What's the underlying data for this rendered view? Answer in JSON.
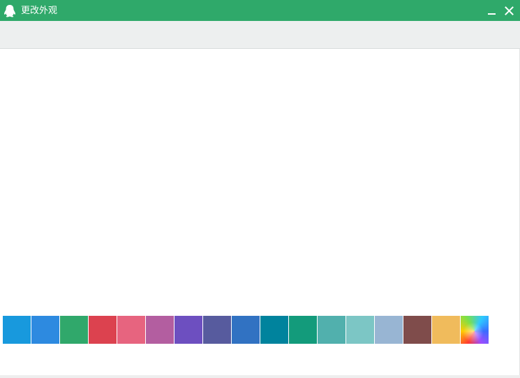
{
  "window": {
    "title": "更改外观",
    "icon": "penguin-icon",
    "minimize_icon": "minimize-icon",
    "close_icon": "close-icon"
  },
  "theme": {
    "titlebar_color": "#2fa96a",
    "toolbar_color": "#edefef"
  },
  "swatches": [
    {
      "name": "sky-blue",
      "color": "#1899dd"
    },
    {
      "name": "blue",
      "color": "#2d8ae0"
    },
    {
      "name": "green",
      "color": "#30a86b"
    },
    {
      "name": "red",
      "color": "#dc424f"
    },
    {
      "name": "pink",
      "color": "#e7647f"
    },
    {
      "name": "orchid",
      "color": "#b35ea0"
    },
    {
      "name": "violet",
      "color": "#6d4fc0"
    },
    {
      "name": "indigo",
      "color": "#575b9e"
    },
    {
      "name": "royal-blue",
      "color": "#3172c2"
    },
    {
      "name": "teal",
      "color": "#00839d"
    },
    {
      "name": "sea-green",
      "color": "#139b7b"
    },
    {
      "name": "aqua",
      "color": "#51b0ad"
    },
    {
      "name": "light-aqua",
      "color": "#7cc6c5"
    },
    {
      "name": "steel-blue",
      "color": "#98b5d3"
    },
    {
      "name": "brown",
      "color": "#7f4c4b"
    },
    {
      "name": "gold",
      "color": "#f0bb5c"
    },
    {
      "name": "rainbow",
      "color": "gradient"
    }
  ]
}
